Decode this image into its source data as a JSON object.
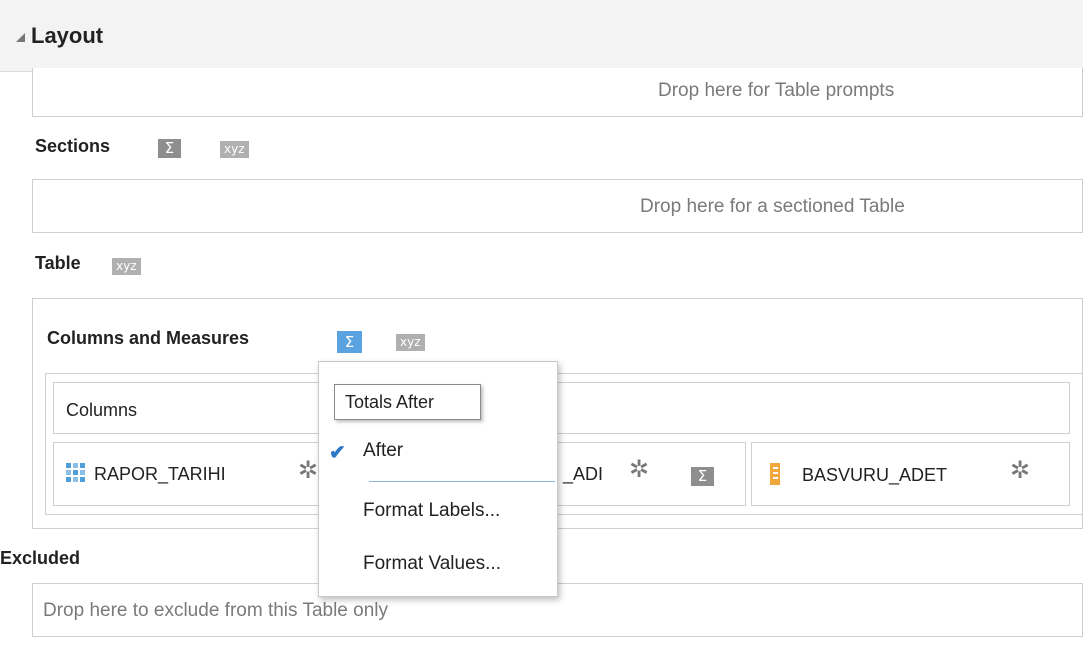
{
  "header": {
    "title": "Layout"
  },
  "prompts_zone": {
    "drop_text": "Drop here for Table prompts"
  },
  "sections": {
    "label": "Sections",
    "sigma_badge": "Σ",
    "xyz_badge": "xyz",
    "drop_text": "Drop here for a sectioned Table"
  },
  "table": {
    "label": "Table",
    "xyz_badge": "xyz",
    "columns_and_measures": {
      "label": "Columns and Measures",
      "sigma_badge": "Σ",
      "xyz_badge": "xyz",
      "columns_header": "Columns",
      "items": [
        {
          "name": "RAPOR_TARIHI",
          "icon": "attribute-grid-icon"
        },
        {
          "name": "_ADI",
          "icon": "attribute-icon",
          "sigma_badge": "Σ"
        },
        {
          "name": "BASVURU_ADET",
          "icon": "measure-ruler-icon"
        }
      ]
    }
  },
  "excluded": {
    "label": "Excluded",
    "drop_text": "Drop here to exclude from this Table only"
  },
  "popup_menu": {
    "tooltip": "Totals After",
    "items": [
      {
        "label": "After",
        "checked": true
      },
      {
        "label": "Format Labels..."
      },
      {
        "label": "Format Values..."
      }
    ]
  },
  "colors": {
    "accent_blue": "#5ba3e0",
    "check_blue": "#2f78c4",
    "measure_orange": "#f2a73b"
  }
}
